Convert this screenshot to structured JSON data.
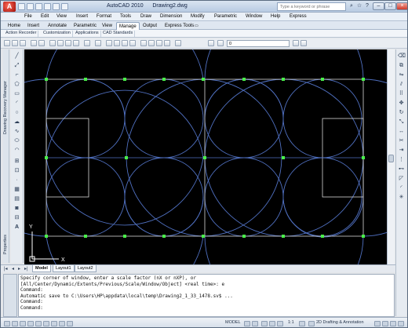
{
  "titlebar": {
    "app_title": "AutoCAD 2010",
    "doc_title": "Drawing2.dwg",
    "search_placeholder": "Type a keyword or phrase",
    "app_button_label": "A"
  },
  "menubar": {
    "items": [
      "File",
      "Edit",
      "View",
      "Insert",
      "Format",
      "Tools",
      "Draw",
      "Dimension",
      "Modify",
      "Parametric",
      "Window",
      "Help",
      "Express"
    ]
  },
  "ribbon": {
    "tabs": [
      "Home",
      "Insert",
      "Annotate",
      "Parametric",
      "View",
      "Manage",
      "Output",
      "Express Tools"
    ],
    "active_tab": "Manage",
    "panels": [
      "Action Recorder",
      "Customization",
      "Applications",
      "CAD Standards"
    ]
  },
  "toolbar": {
    "layer_value": "0"
  },
  "palettes": {
    "recovery_label": "Drawing Recovery Manager",
    "properties_label": "Properties"
  },
  "layout_tabs": {
    "tabs": [
      "Model",
      "Layout1",
      "Layout2"
    ],
    "active": "Model"
  },
  "command_lines": [
    "Specify corner of window, enter a scale factor (nX or nXP), or",
    "[All/Center/Dynamic/Extents/Previous/Scale/Window/Object] <real time>: e",
    "Command:",
    "Automatic save to C:\\Users\\HP\\appdata\\local\\temp\\Drawing2_1_33_1478.sv$ ...",
    "Command:",
    "",
    "Command:"
  ],
  "statusbar": {
    "model_label": "MODEL",
    "scale_label": "1:1",
    "workspace_label": "2D Drafting & Annotation"
  },
  "ucs": {
    "x_label": "X",
    "y_label": "Y"
  },
  "colors": {
    "canvas": "#000000",
    "lines_white": "#ffffff",
    "arcs_blue": "#4f6fbf",
    "grips_green": "#49f049"
  },
  "icons": [
    "new-file-icon",
    "open-icon",
    "save-icon",
    "undo-icon",
    "redo-icon",
    "pan-icon",
    "zoom-icon",
    "line-icon",
    "circle-icon",
    "arc-icon",
    "rectangle-icon",
    "hatch-icon",
    "text-icon",
    "erase-icon",
    "move-icon",
    "copy-icon"
  ]
}
